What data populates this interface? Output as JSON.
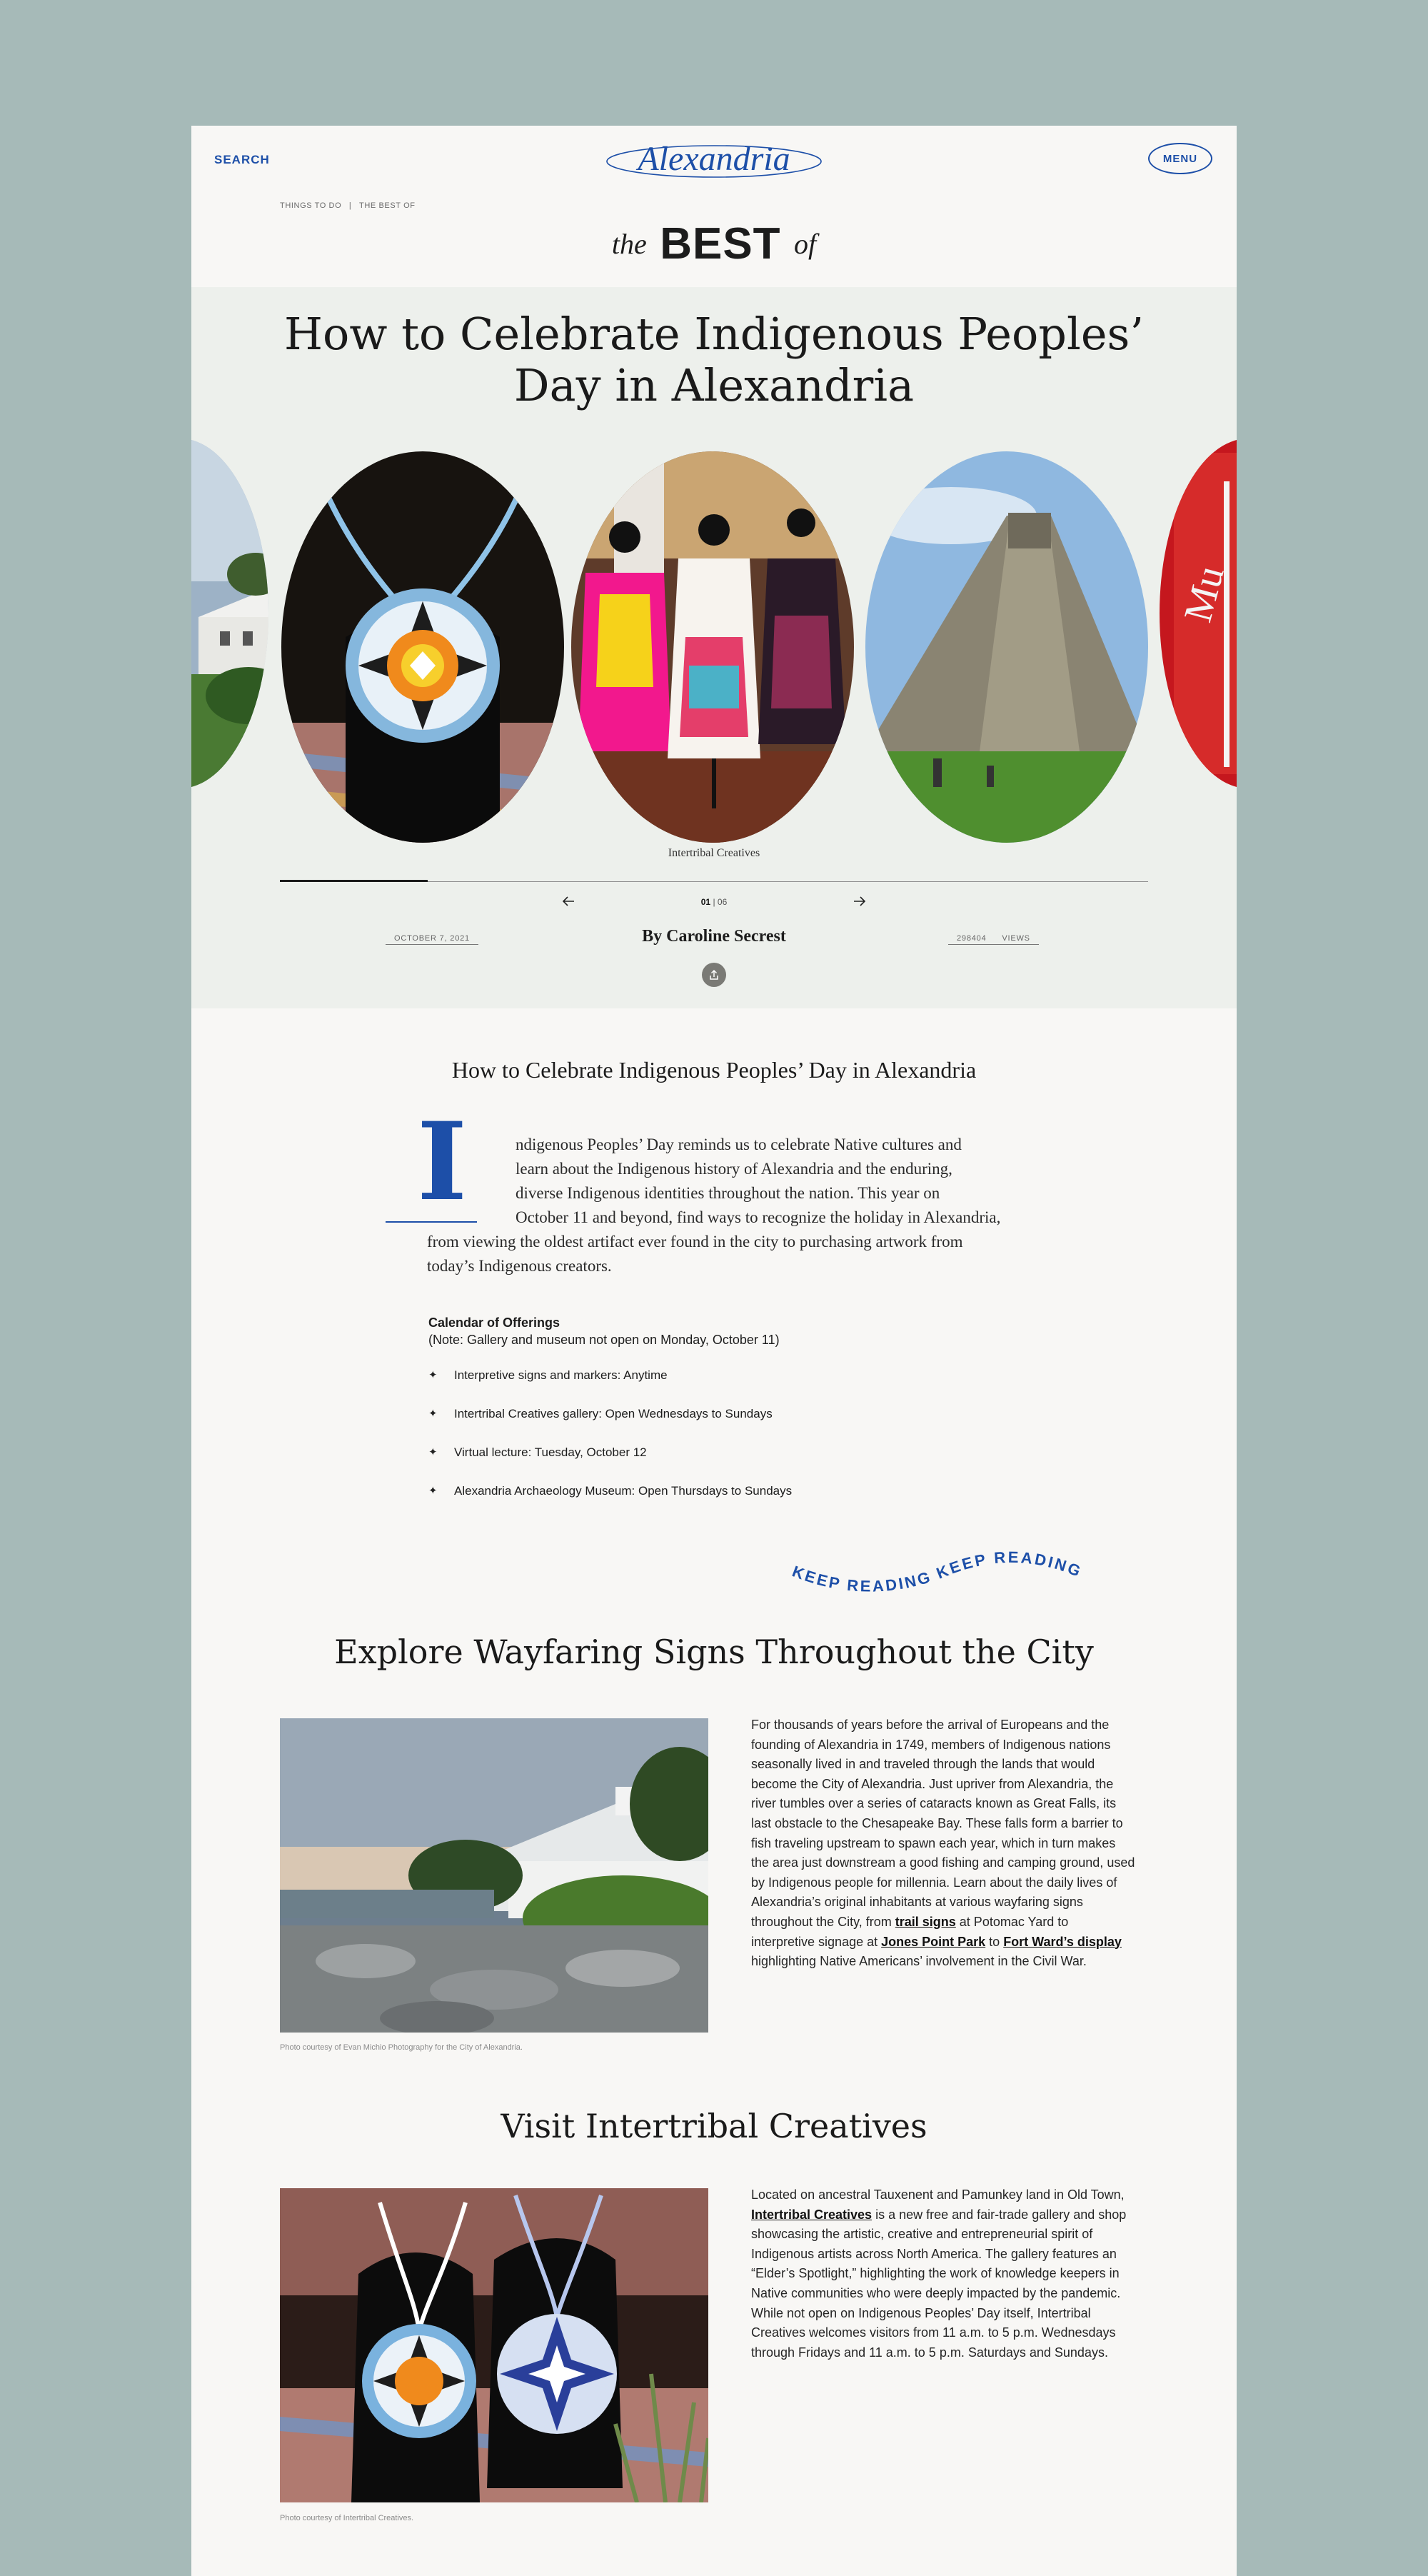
{
  "header": {
    "search_label": "SEARCH",
    "logo_text": "Alexandria",
    "menu_label": "MENU"
  },
  "breadcrumbs": [
    "THINGS TO DO",
    "|",
    "THE BEST OF"
  ],
  "best_of": {
    "pre": "the",
    "main": "BEST",
    "post": "of"
  },
  "hero": {
    "title_line1": "How to Celebrate Indigenous Peoples’",
    "title_line2": "Day in Alexandria",
    "active_caption": "Intertribal Creatives",
    "pager_current": "01",
    "pager_sep": "|",
    "pager_total": "06",
    "progress_fraction": 0.17
  },
  "meta": {
    "date": "OCTOBER 7, 2021",
    "author": "By Caroline Secrest",
    "views_count": "298404",
    "views_label": "VIEWS"
  },
  "article": {
    "title": "How to Celebrate Indigenous Peoples’ Day in Alexandria",
    "dropcap": "I",
    "intro_lines": [
      "ndigenous Peoples’ Day reminds us to celebrate Native cultures and",
      "learn about the Indigenous history of Alexandria and the enduring,",
      "diverse Indigenous identities throughout the nation. This year on",
      "October 11 and beyond, find ways to recognize the holiday in Alexandria,",
      "from viewing the oldest artifact ever found in the city to purchasing artwork from",
      "today’s Indigenous creators."
    ],
    "calendar_title": "Calendar of Offerings",
    "calendar_note": "(Note: Gallery and museum not open on Monday, October 11)",
    "offerings": [
      "Interpretive signs and markers: Anytime",
      "Intertribal Creatives gallery: Open Wednesdays to Sundays",
      "Virtual lecture: Tuesday, October 12",
      "Alexandria Archaeology Museum: Open Thursdays to Sundays"
    ],
    "keep_reading": "KEEP READING KEEP READING"
  },
  "section1": {
    "title": "Explore Wayfaring Signs Throughout the City",
    "photo_caption": "Photo courtesy of Evan Michio Photography for the City of Alexandria.",
    "lines": [
      "For thousands of years before the arrival of Europeans and the",
      "founding of Alexandria in 1749, members of Indigenous nations",
      "seasonally lived in and traveled through the lands that would",
      "become the City of Alexandria. Just upriver from Alexandria, the",
      "river tumbles over a series of cataracts known as Great Falls, its",
      "last obstacle to the Chesapeake Bay. These falls form a barrier to",
      "fish traveling upstream to spawn each year, which in turn makes",
      "the area just downstream a good fishing and camping ground, used",
      "by Indigenous people for millennia. Learn about the daily lives of",
      "Alexandria’s original inhabitants at various wayfaring signs"
    ],
    "line11_pre": "throughout the City, from ",
    "link_trail": "trail signs",
    "line11_post": " at Potomac Yard to",
    "line12_pre": "interpretive signage at ",
    "link_jones": "Jones Point Park",
    "line12_mid": " to ",
    "link_fortward": "Fort Ward’s display",
    "line13": "highlighting Native Americans’ involvement in the Civil War."
  },
  "section2": {
    "title": "Visit Intertribal Creatives",
    "photo_caption": "Photo courtesy of Intertribal Creatives.",
    "line1": "Located on ancestral Tauxenent and Pamunkey land in Old Town,",
    "link_ic": "Intertribal Creatives",
    "line2_post": " is a new free and fair-trade gallery and shop",
    "lines": [
      "showcasing the artistic, creative and entrepreneurial spirit of",
      "Indigenous artists across North America. The gallery features an",
      "“Elder’s Spotlight,” highlighting the work of knowledge keepers in",
      "Native communities who were deeply impacted by the pandemic.",
      "While not open on Indigenous Peoples’ Day itself, Intertribal",
      "Creatives welcomes visitors from 11 a.m. to 5 p.m. Wednesdays",
      "through Fridays and 11 a.m. to 5 p.m. Saturdays and Sundays."
    ]
  },
  "colors": {
    "page_bg": "#a6bab8",
    "content_bg": "#f8f7f5",
    "hero_bg": "#edf0ec",
    "accent_blue": "#1d4fa8"
  },
  "icons": {
    "prev": "arrow-left-icon",
    "next": "arrow-right-icon",
    "share": "share-icon",
    "bullet": "four-point-star-icon"
  }
}
